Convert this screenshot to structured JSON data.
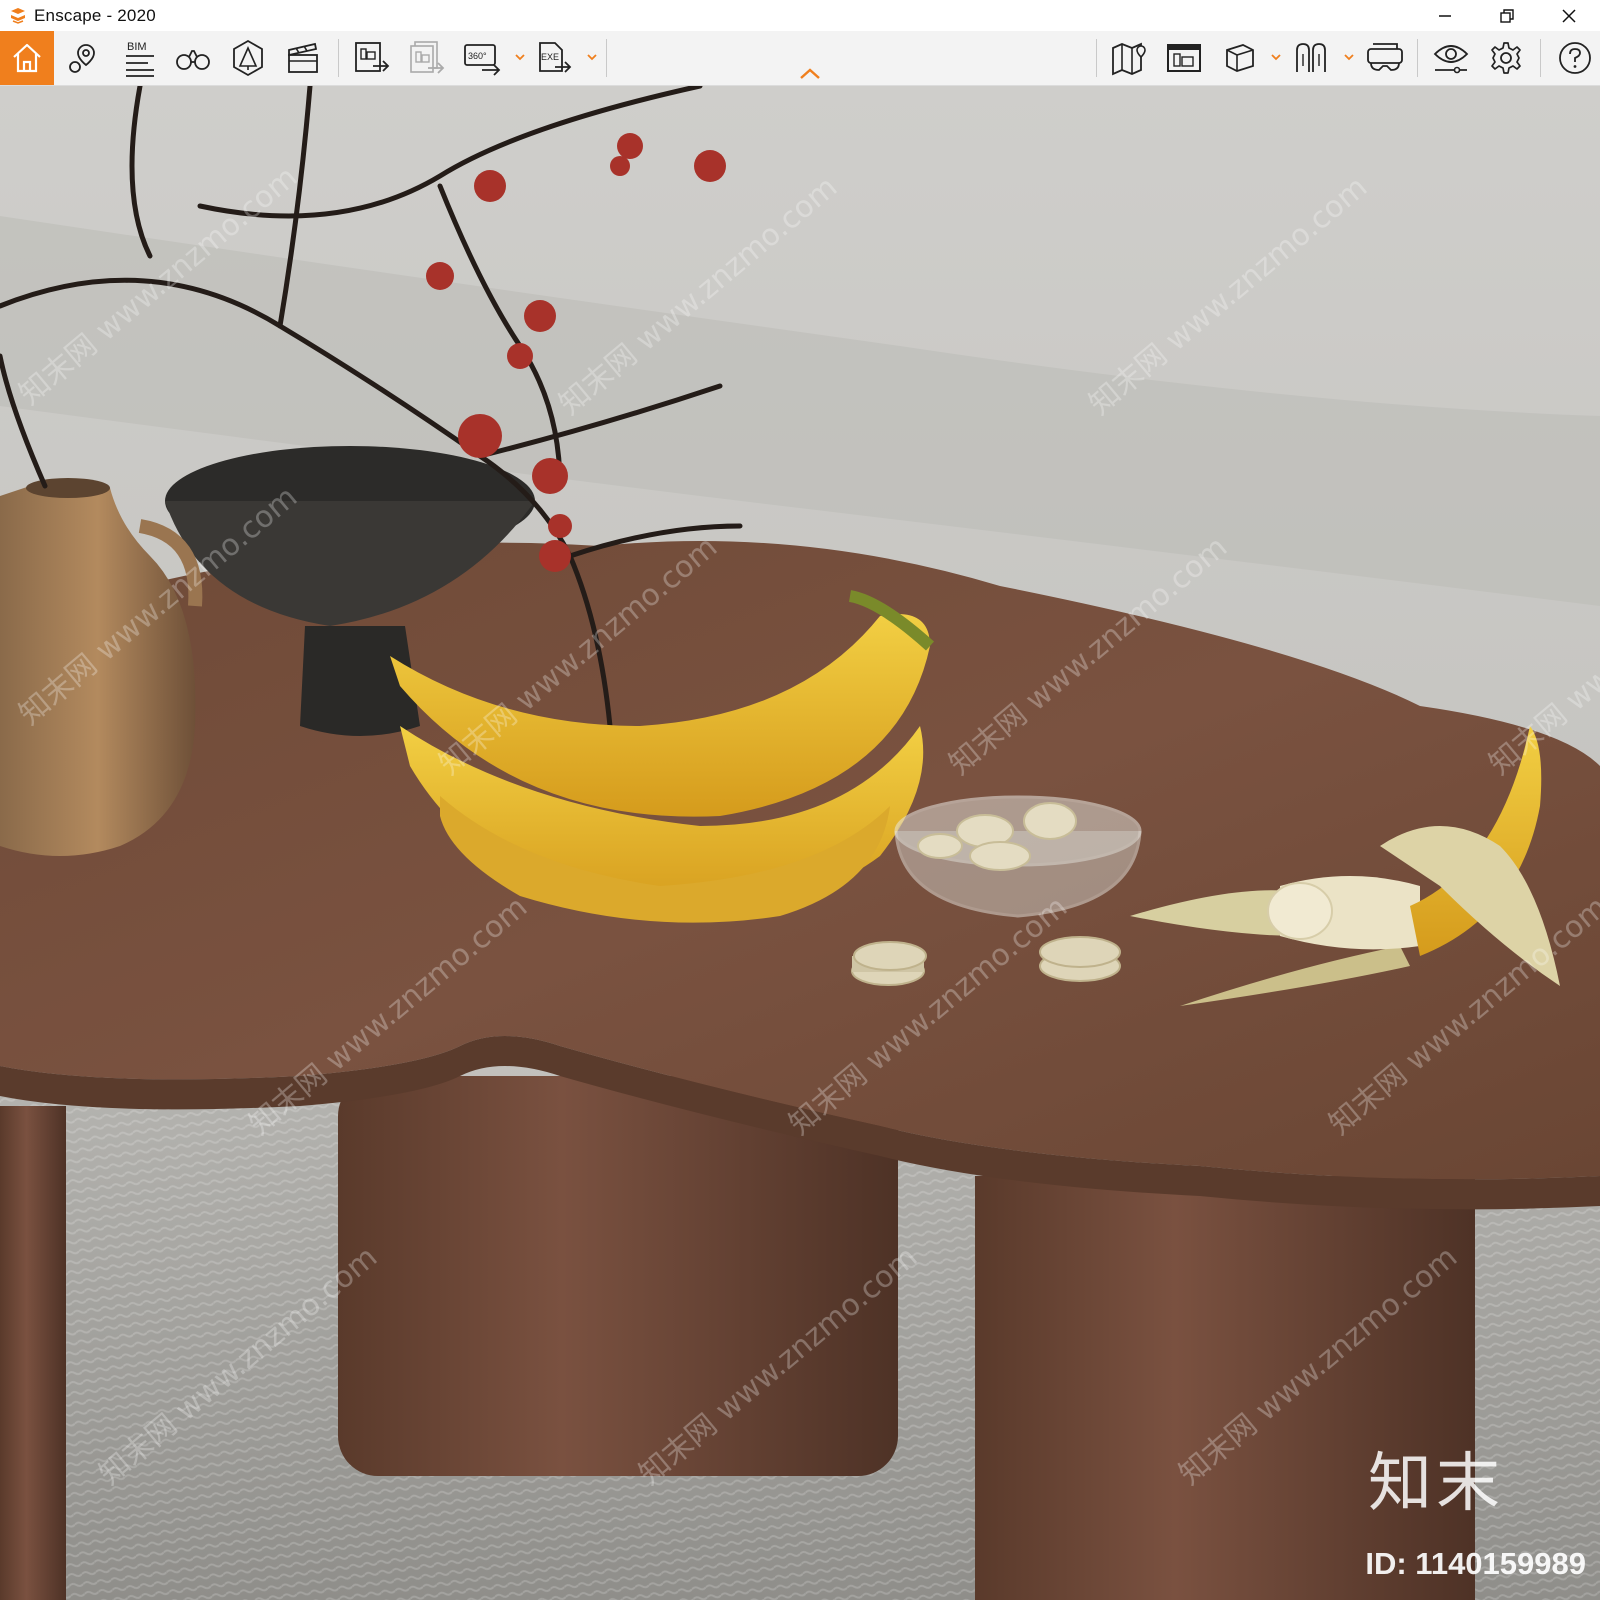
{
  "window": {
    "title": "Enscape - 2020",
    "controls": [
      "minimize",
      "restore",
      "close"
    ]
  },
  "toolbar": {
    "left_buttons": [
      {
        "name": "home",
        "icon": "home-icon",
        "active": true
      },
      {
        "name": "location",
        "icon": "location-pin-icon"
      },
      {
        "name": "bim",
        "icon": "bim-info-icon",
        "label": "BIM"
      },
      {
        "name": "views",
        "icon": "binoculars-icon"
      },
      {
        "name": "atmosphere",
        "icon": "atmosphere-icon"
      },
      {
        "name": "video-editor",
        "icon": "clapperboard-icon"
      }
    ],
    "export_buttons": [
      {
        "name": "export-screenshot",
        "icon": "export-image-icon"
      },
      {
        "name": "batch-render",
        "icon": "batch-render-icon"
      },
      {
        "name": "export-360",
        "icon": "export-360-icon",
        "label": "360°"
      },
      {
        "name": "export-exe",
        "icon": "export-exe-icon",
        "label": "EXE"
      }
    ],
    "right_buttons": [
      {
        "name": "map",
        "icon": "map-icon"
      },
      {
        "name": "asset-library",
        "icon": "asset-library-icon"
      },
      {
        "name": "orthographic",
        "icon": "cube-icon"
      },
      {
        "name": "section",
        "icon": "section-icon"
      },
      {
        "name": "vr-headset",
        "icon": "vr-headset-icon"
      },
      {
        "name": "visual-settings",
        "icon": "eye-settings-icon"
      },
      {
        "name": "general-settings",
        "icon": "gear-icon"
      },
      {
        "name": "help",
        "icon": "help-icon"
      }
    ],
    "accent_color": "#f07f1d"
  },
  "viewport": {
    "watermark_text": "知末网 www.znzmo.com",
    "brand_mark": "知末",
    "id_label": "ID: 1140159989"
  }
}
